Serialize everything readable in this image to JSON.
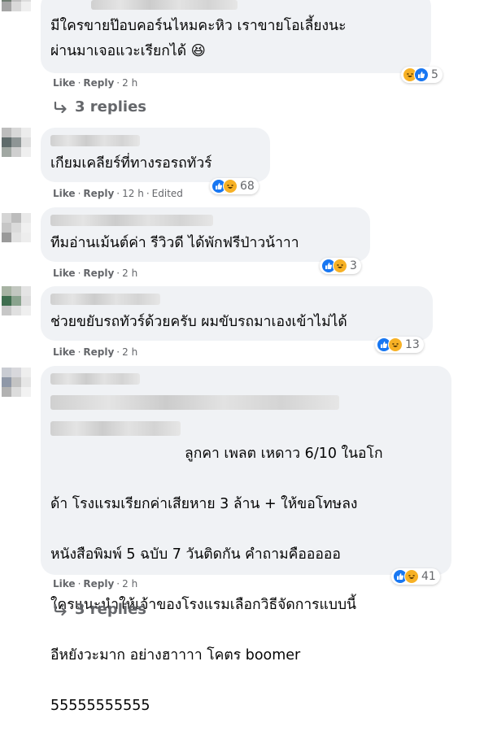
{
  "comments": [
    {
      "text": "มีใครขายป๊อบคอร์นไหมคะหิว เราขายโอเลี้ยงนะ\nผ่านมาเจอแวะเรียกได้ 😆",
      "actions": {
        "like": "Like",
        "reply": "Reply",
        "time": "2 h"
      },
      "reactions": {
        "icons": [
          "haha-icon",
          "like-icon"
        ],
        "count": "5"
      },
      "replies": "3 replies"
    },
    {
      "text": "เกียมเคลียร์ที่ทางรอรถทัวร์",
      "actions": {
        "like": "Like",
        "reply": "Reply",
        "time": "12 h",
        "edited": "Edited"
      },
      "reactions": {
        "icons": [
          "like-icon",
          "haha-icon"
        ],
        "count": "68"
      }
    },
    {
      "text": "ทีมอ่านเม้นต์ค่า รีวิวดี ได้พักฟรีป่าวน้าาา",
      "actions": {
        "like": "Like",
        "reply": "Reply",
        "time": "2 h"
      },
      "reactions": {
        "icons": [
          "like-icon",
          "haha-icon"
        ],
        "count": "3"
      }
    },
    {
      "text": "ช่วยขยับรถทัวร์ด้วยครับ ผมขับรถมาเองเข้าไม่ได้",
      "actions": {
        "like": "Like",
        "reply": "Reply",
        "time": "2 h"
      },
      "reactions": {
        "icons": [
          "like-icon",
          "haha-icon"
        ],
        "count": "13"
      }
    },
    {
      "lines": [
        "ลูกคา เพลต เหดาว 6/10 ในอโก",
        "ด้า โรงแรมเรียกค่าเสียหาย 3 ล้าน + ให้ขอโทษลง",
        "หนังสือพิมพ์ 5 ฉบับ 7 วันติดกัน คำถามคือออออ",
        "ใครแนะนำให้เจ้าของโรงแรมเลือกวิธีจัดการแบบนี้",
        "อีหยังวะมาก อย่างฮาาาา โคตร boomer",
        "55555555555"
      ],
      "actions": {
        "like": "Like",
        "reply": "Reply",
        "time": "2 h"
      },
      "reactions": {
        "icons": [
          "like-icon",
          "haha-icon"
        ],
        "count": "41"
      },
      "replies": "3 replies"
    }
  ],
  "colors": {
    "like": "#1877f2",
    "haha": "#f7b125",
    "bubble": "#f0f2f5",
    "meta": "#65676b"
  }
}
